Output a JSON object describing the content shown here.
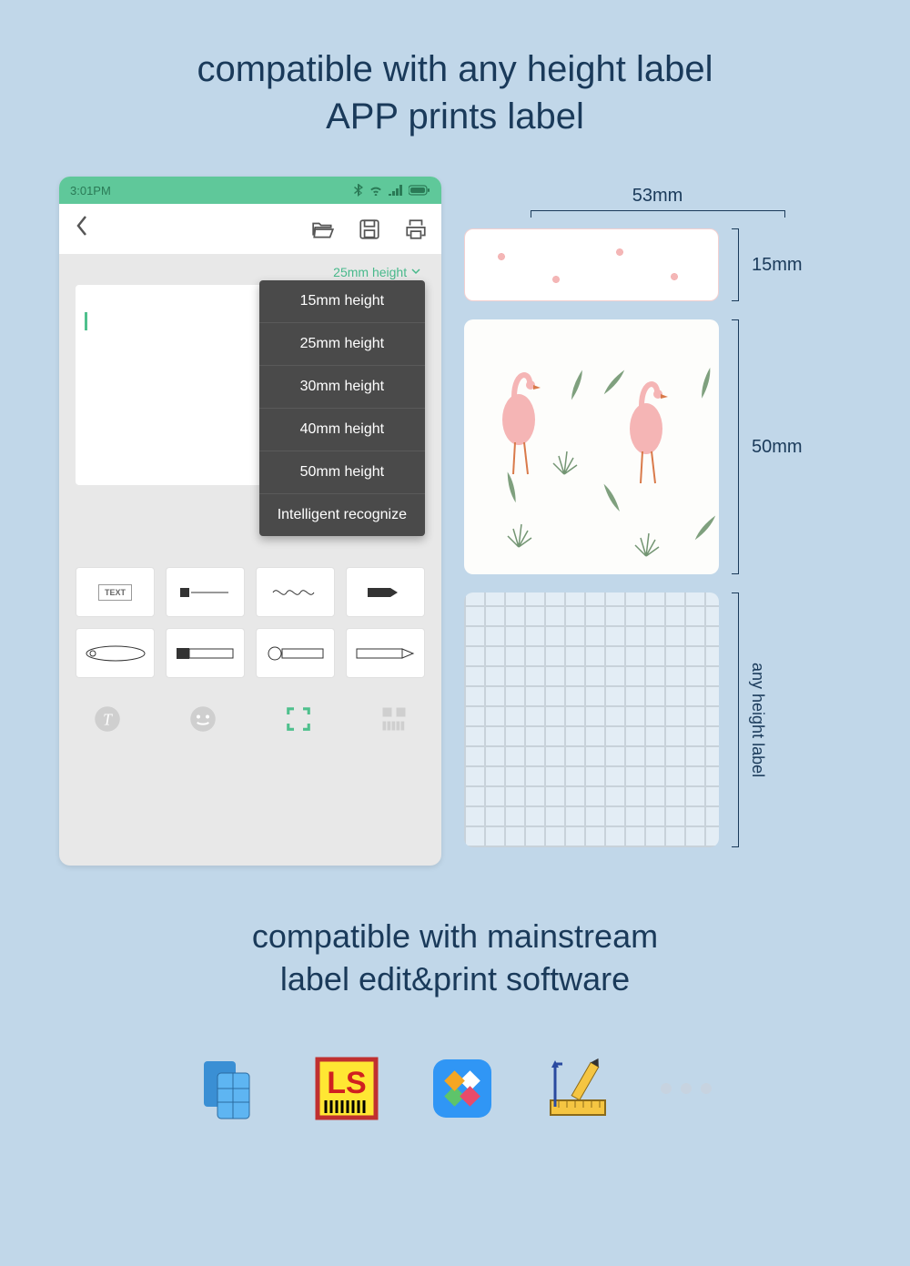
{
  "heading": {
    "line1": "compatible with any height label",
    "line2": "APP prints label"
  },
  "phone": {
    "time": "3:01PM",
    "height_selected": "25mm height",
    "dropdown": [
      "15mm height",
      "25mm height",
      "30mm height",
      "40mm height",
      "50mm height",
      "Intelligent recognize"
    ],
    "template_text": "TEXT"
  },
  "samples": {
    "width_dim": "53mm",
    "dim_15": "15mm",
    "dim_50": "50mm",
    "any_label": "any height label"
  },
  "subheading": {
    "line1": "compatible with mainstream",
    "line2": "label edit&print software"
  },
  "software": {
    "ls": "LS"
  }
}
